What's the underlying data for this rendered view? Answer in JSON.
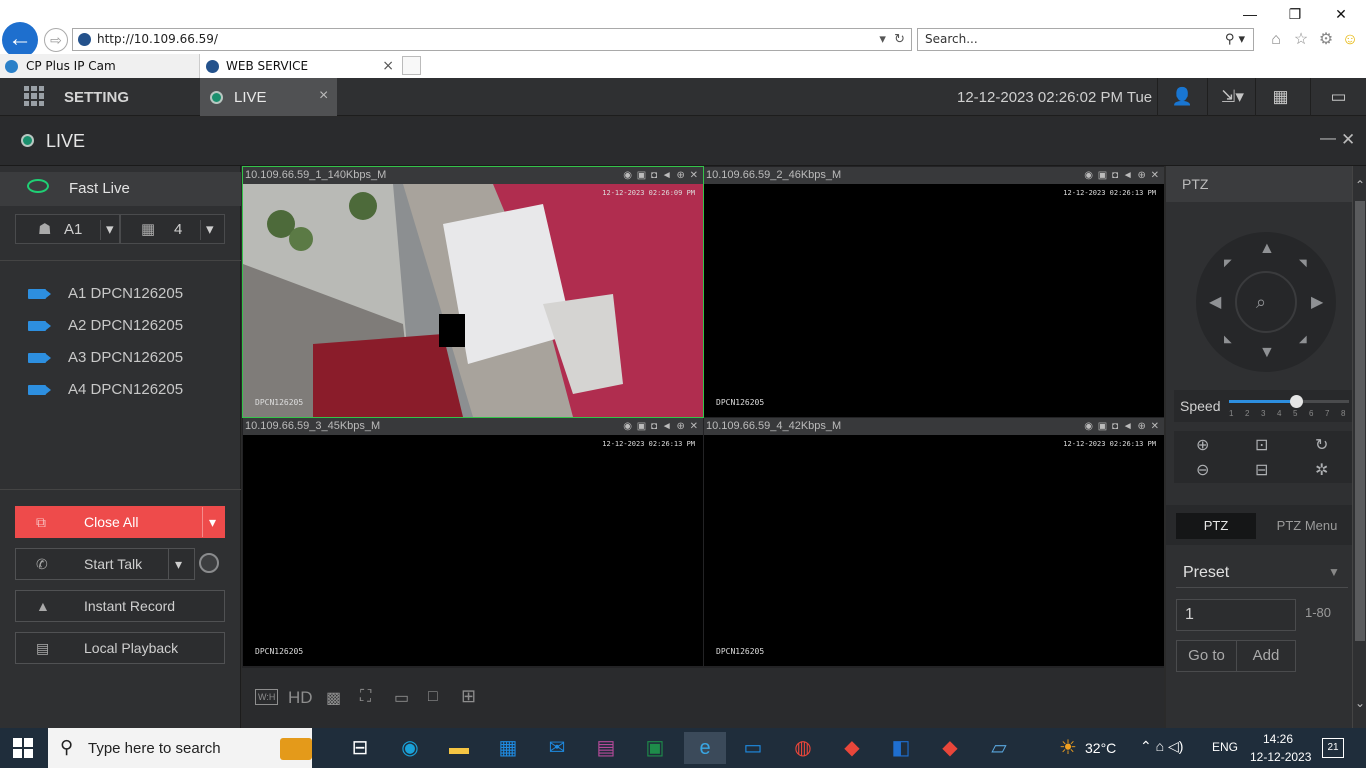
{
  "browser": {
    "url": "http://10.109.66.59/",
    "search_placeholder": "Search...",
    "tabs": [
      {
        "label": "CP Plus IP Cam"
      },
      {
        "label": "WEB SERVICE",
        "close": "×"
      }
    ],
    "window_buttons": {
      "min": "—",
      "restore": "❐",
      "close": "✕"
    }
  },
  "header": {
    "setting": "SETTING",
    "live_tab": "LIVE",
    "live_close": "×",
    "datetime": "12-12-2023 02:26:02 PM Tue"
  },
  "title_bar": {
    "title": "LIVE",
    "minimize": "—",
    "close": "✕"
  },
  "left": {
    "fast_live": "Fast Live",
    "device": "A1",
    "layout": "4",
    "cameras": [
      {
        "label": "A1 DPCN126205"
      },
      {
        "label": "A2 DPCN126205"
      },
      {
        "label": "A3 DPCN126205"
      },
      {
        "label": "A4 DPCN126205"
      }
    ],
    "close_all": "Close All",
    "start_talk": "Start Talk",
    "instant_record": "Instant Record",
    "local_playback": "Local Playback"
  },
  "video": {
    "panes": [
      {
        "title": "10.109.66.59_1_140Kbps_M",
        "timestamp": "12-12-2023 02:26:09 PM",
        "osd": "DPCN126205"
      },
      {
        "title": "10.109.66.59_2_46Kbps_M",
        "timestamp": "12-12-2023 02:26:13 PM",
        "osd": "DPCN126205"
      },
      {
        "title": "10.109.66.59_3_45Kbps_M",
        "timestamp": "12-12-2023 02:26:13 PM",
        "osd": "DPCN126205"
      },
      {
        "title": "10.109.66.59_4_42Kbps_M",
        "timestamp": "12-12-2023 02:26:13 PM",
        "osd": "DPCN126205"
      }
    ],
    "toolbar": {
      "wh": "W:H",
      "hd": "HD"
    }
  },
  "ptz": {
    "title": "PTZ",
    "speed_label": "Speed",
    "speed_value": 5,
    "speed_ticks": [
      "1",
      "2",
      "3",
      "4",
      "5",
      "6",
      "7",
      "8"
    ],
    "tab_ptz": "PTZ",
    "tab_menu": "PTZ Menu",
    "preset": "Preset",
    "preset_value": "1",
    "preset_range": "1-80",
    "goto": "Go to",
    "add": "Add"
  },
  "taskbar": {
    "search": "Type here to search",
    "temperature": "32°C",
    "lang": "ENG",
    "time": "14:26",
    "date": "12-12-2023",
    "notifications": "21"
  },
  "colors": {
    "accent": "#2d8fe0",
    "close_all": "#ee4b4b",
    "live_dot": "#1a8f6d"
  }
}
